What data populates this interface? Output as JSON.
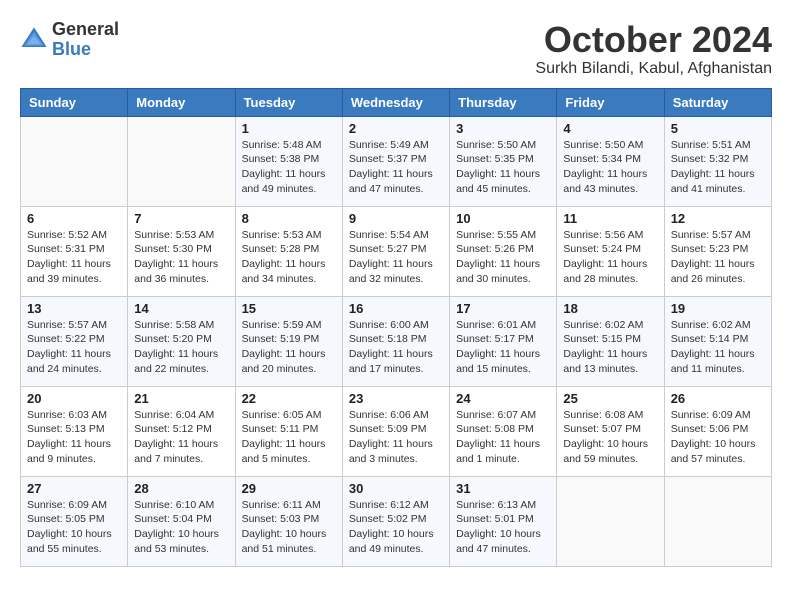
{
  "logo": {
    "general": "General",
    "blue": "Blue"
  },
  "header": {
    "month": "October 2024",
    "location": "Surkh Bilandi, Kabul, Afghanistan"
  },
  "weekdays": [
    "Sunday",
    "Monday",
    "Tuesday",
    "Wednesday",
    "Thursday",
    "Friday",
    "Saturday"
  ],
  "weeks": [
    [
      {
        "day": "",
        "info": ""
      },
      {
        "day": "",
        "info": ""
      },
      {
        "day": "1",
        "info": "Sunrise: 5:48 AM\nSunset: 5:38 PM\nDaylight: 11 hours and 49 minutes."
      },
      {
        "day": "2",
        "info": "Sunrise: 5:49 AM\nSunset: 5:37 PM\nDaylight: 11 hours and 47 minutes."
      },
      {
        "day": "3",
        "info": "Sunrise: 5:50 AM\nSunset: 5:35 PM\nDaylight: 11 hours and 45 minutes."
      },
      {
        "day": "4",
        "info": "Sunrise: 5:50 AM\nSunset: 5:34 PM\nDaylight: 11 hours and 43 minutes."
      },
      {
        "day": "5",
        "info": "Sunrise: 5:51 AM\nSunset: 5:32 PM\nDaylight: 11 hours and 41 minutes."
      }
    ],
    [
      {
        "day": "6",
        "info": "Sunrise: 5:52 AM\nSunset: 5:31 PM\nDaylight: 11 hours and 39 minutes."
      },
      {
        "day": "7",
        "info": "Sunrise: 5:53 AM\nSunset: 5:30 PM\nDaylight: 11 hours and 36 minutes."
      },
      {
        "day": "8",
        "info": "Sunrise: 5:53 AM\nSunset: 5:28 PM\nDaylight: 11 hours and 34 minutes."
      },
      {
        "day": "9",
        "info": "Sunrise: 5:54 AM\nSunset: 5:27 PM\nDaylight: 11 hours and 32 minutes."
      },
      {
        "day": "10",
        "info": "Sunrise: 5:55 AM\nSunset: 5:26 PM\nDaylight: 11 hours and 30 minutes."
      },
      {
        "day": "11",
        "info": "Sunrise: 5:56 AM\nSunset: 5:24 PM\nDaylight: 11 hours and 28 minutes."
      },
      {
        "day": "12",
        "info": "Sunrise: 5:57 AM\nSunset: 5:23 PM\nDaylight: 11 hours and 26 minutes."
      }
    ],
    [
      {
        "day": "13",
        "info": "Sunrise: 5:57 AM\nSunset: 5:22 PM\nDaylight: 11 hours and 24 minutes."
      },
      {
        "day": "14",
        "info": "Sunrise: 5:58 AM\nSunset: 5:20 PM\nDaylight: 11 hours and 22 minutes."
      },
      {
        "day": "15",
        "info": "Sunrise: 5:59 AM\nSunset: 5:19 PM\nDaylight: 11 hours and 20 minutes."
      },
      {
        "day": "16",
        "info": "Sunrise: 6:00 AM\nSunset: 5:18 PM\nDaylight: 11 hours and 17 minutes."
      },
      {
        "day": "17",
        "info": "Sunrise: 6:01 AM\nSunset: 5:17 PM\nDaylight: 11 hours and 15 minutes."
      },
      {
        "day": "18",
        "info": "Sunrise: 6:02 AM\nSunset: 5:15 PM\nDaylight: 11 hours and 13 minutes."
      },
      {
        "day": "19",
        "info": "Sunrise: 6:02 AM\nSunset: 5:14 PM\nDaylight: 11 hours and 11 minutes."
      }
    ],
    [
      {
        "day": "20",
        "info": "Sunrise: 6:03 AM\nSunset: 5:13 PM\nDaylight: 11 hours and 9 minutes."
      },
      {
        "day": "21",
        "info": "Sunrise: 6:04 AM\nSunset: 5:12 PM\nDaylight: 11 hours and 7 minutes."
      },
      {
        "day": "22",
        "info": "Sunrise: 6:05 AM\nSunset: 5:11 PM\nDaylight: 11 hours and 5 minutes."
      },
      {
        "day": "23",
        "info": "Sunrise: 6:06 AM\nSunset: 5:09 PM\nDaylight: 11 hours and 3 minutes."
      },
      {
        "day": "24",
        "info": "Sunrise: 6:07 AM\nSunset: 5:08 PM\nDaylight: 11 hours and 1 minute."
      },
      {
        "day": "25",
        "info": "Sunrise: 6:08 AM\nSunset: 5:07 PM\nDaylight: 10 hours and 59 minutes."
      },
      {
        "day": "26",
        "info": "Sunrise: 6:09 AM\nSunset: 5:06 PM\nDaylight: 10 hours and 57 minutes."
      }
    ],
    [
      {
        "day": "27",
        "info": "Sunrise: 6:09 AM\nSunset: 5:05 PM\nDaylight: 10 hours and 55 minutes."
      },
      {
        "day": "28",
        "info": "Sunrise: 6:10 AM\nSunset: 5:04 PM\nDaylight: 10 hours and 53 minutes."
      },
      {
        "day": "29",
        "info": "Sunrise: 6:11 AM\nSunset: 5:03 PM\nDaylight: 10 hours and 51 minutes."
      },
      {
        "day": "30",
        "info": "Sunrise: 6:12 AM\nSunset: 5:02 PM\nDaylight: 10 hours and 49 minutes."
      },
      {
        "day": "31",
        "info": "Sunrise: 6:13 AM\nSunset: 5:01 PM\nDaylight: 10 hours and 47 minutes."
      },
      {
        "day": "",
        "info": ""
      },
      {
        "day": "",
        "info": ""
      }
    ]
  ]
}
